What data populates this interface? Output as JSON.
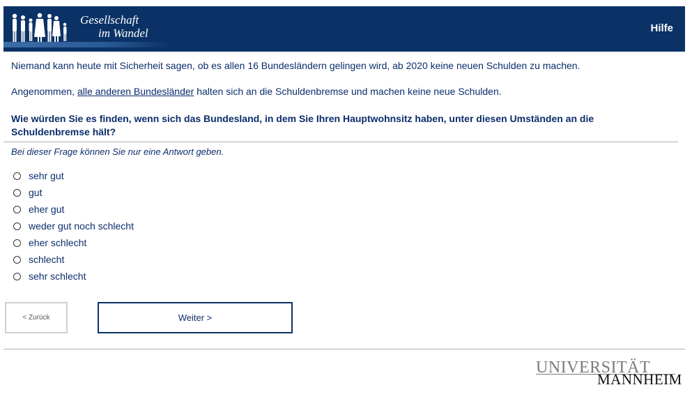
{
  "header": {
    "brand_line1": "Gesellschaft",
    "brand_line2": "im Wandel",
    "help_label": "Hilfe",
    "bg_color": "#0b3266"
  },
  "intro": {
    "line1": "Niemand kann heute mit Sicherheit sagen, ob es allen 16 Bundesländern gelingen wird, ab 2020 keine neuen Schulden zu machen.",
    "line2_prefix": "Angenommen, ",
    "line2_underlined": "alle anderen Bundesländer",
    "line2_suffix": " halten sich an die Schuldenbremse und machen keine neue Schulden."
  },
  "question": {
    "text": "Wie würden Sie es finden, wenn sich das Bundesland, in dem Sie Ihren Hauptwohnsitz haben, unter diesen Umständen an die Schuldenbremse hält?",
    "hint": "Bei dieser Frage können Sie nur eine Antwort geben."
  },
  "options": [
    {
      "label": "sehr gut"
    },
    {
      "label": "gut"
    },
    {
      "label": "eher gut"
    },
    {
      "label": "weder gut noch schlecht"
    },
    {
      "label": "eher schlecht"
    },
    {
      "label": "schlecht"
    },
    {
      "label": "sehr schlecht"
    }
  ],
  "nav": {
    "back_label": "< Zurück",
    "next_label": "Weiter >"
  },
  "footer": {
    "logo_line1": "UNIVERSITÄT",
    "logo_line2": "MANNHEIM"
  }
}
